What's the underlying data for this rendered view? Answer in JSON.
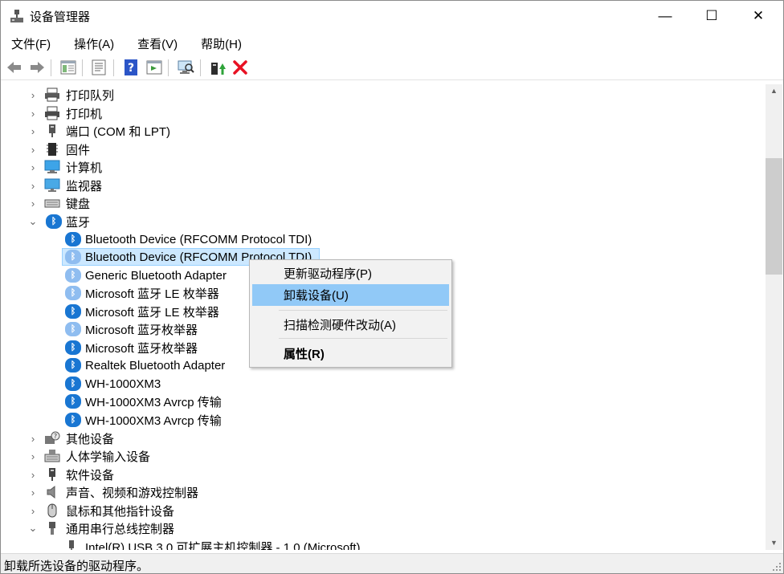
{
  "window": {
    "title": "设备管理器",
    "controls": {
      "minimize": "—",
      "maximize": "☐",
      "close": "✕"
    }
  },
  "menu": [
    "文件(F)",
    "操作(A)",
    "查看(V)",
    "帮助(H)"
  ],
  "toolbar": {
    "icons": [
      "back-icon",
      "forward-icon",
      "show-hide-tree-icon",
      "properties-icon",
      "help-icon",
      "action-pane-icon",
      "scan-hardware-icon",
      "update-driver-icon",
      "uninstall-icon"
    ]
  },
  "tree": {
    "categories_top": [
      {
        "label": "打印队列",
        "icon": "print-queue-icon",
        "expanded": false
      },
      {
        "label": "打印机",
        "icon": "printer-icon",
        "expanded": false
      },
      {
        "label": "端口 (COM 和 LPT)",
        "icon": "port-icon",
        "expanded": false
      },
      {
        "label": "固件",
        "icon": "firmware-icon",
        "expanded": false
      },
      {
        "label": "计算机",
        "icon": "computer-icon",
        "expanded": false
      },
      {
        "label": "监视器",
        "icon": "monitor-icon",
        "expanded": false
      },
      {
        "label": "键盘",
        "icon": "keyboard-icon",
        "expanded": false
      }
    ],
    "bluetooth": {
      "label": "蓝牙",
      "icon": "bluetooth-icon",
      "expanded": true,
      "children": [
        "Bluetooth Device (RFCOMM Protocol TDI)",
        "Bluetooth Device (RFCOMM Protocol TDI)",
        "Generic Bluetooth Adapter",
        "Microsoft 蓝牙 LE 枚举器",
        "Microsoft 蓝牙 LE 枚举器",
        "Microsoft 蓝牙枚举器",
        "Microsoft 蓝牙枚举器",
        "Realtek Bluetooth Adapter",
        "WH-1000XM3",
        "WH-1000XM3 Avrcp 传输",
        "WH-1000XM3 Avrcp 传输"
      ],
      "selected_index": 1
    },
    "categories_bottom": [
      {
        "label": "其他设备",
        "icon": "other-devices-icon",
        "expanded": false
      },
      {
        "label": "人体学输入设备",
        "icon": "hid-icon",
        "expanded": false
      },
      {
        "label": "软件设备",
        "icon": "software-device-icon",
        "expanded": false
      },
      {
        "label": "声音、视频和游戏控制器",
        "icon": "audio-icon",
        "expanded": false
      },
      {
        "label": "鼠标和其他指针设备",
        "icon": "mouse-icon",
        "expanded": false
      },
      {
        "label": "通用串行总线控制器",
        "icon": "usb-icon",
        "expanded": true
      }
    ],
    "usb_child": "Intel(R) USB 3.0 可扩展主机控制器 - 1.0 (Microsoft)"
  },
  "context_menu": {
    "items": [
      {
        "label": "更新驱动程序(P)",
        "highlighted": false,
        "bold": false
      },
      {
        "label": "卸载设备(U)",
        "highlighted": true,
        "bold": false
      },
      {
        "label": "扫描检测硬件改动(A)",
        "highlighted": false,
        "bold": false
      },
      {
        "label": "属性(R)",
        "highlighted": false,
        "bold": true
      }
    ]
  },
  "status": {
    "text": "卸载所选设备的驱动程序。"
  },
  "colors": {
    "selection": "#cce8ff",
    "menu_highlight": "#91c9f7",
    "bluetooth": "#1976d2",
    "uninstall_red": "#e81123"
  }
}
